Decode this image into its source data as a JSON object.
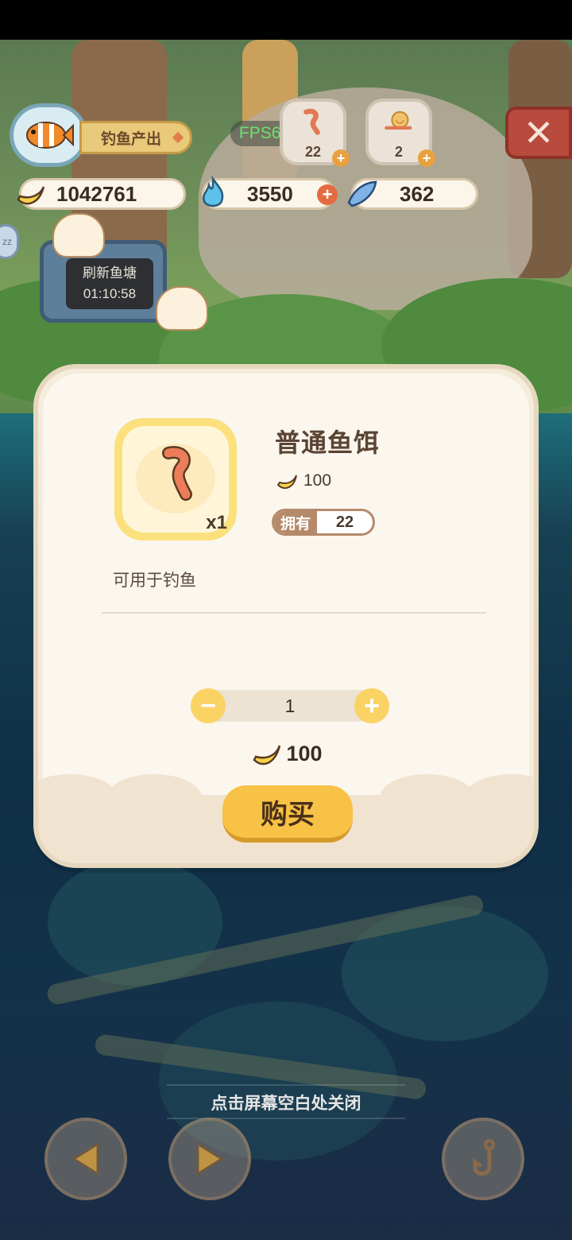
{
  "hud": {
    "fishing_output_label": "钓鱼产出",
    "fps": "FPS60",
    "bait_slots": [
      {
        "name": "worm-bait",
        "count": "22"
      },
      {
        "name": "snail-bait",
        "count": "2"
      }
    ],
    "currencies": [
      {
        "name": "banana",
        "value": "1042761"
      },
      {
        "name": "blue-flame",
        "value": "3550"
      },
      {
        "name": "blue-fish",
        "value": "362"
      }
    ],
    "refresh_pond": {
      "label": "刷新鱼塘",
      "timer": "01:10:58"
    }
  },
  "dialog": {
    "item_name": "普通鱼饵",
    "item_qty": "x1",
    "unit_price": "100",
    "owned_label": "拥有",
    "owned_value": "22",
    "description": "可用于钓鱼",
    "quantity": "1",
    "total_price": "100",
    "buy_label": "购买"
  },
  "hint": "点击屏幕空白处关闭",
  "colors": {
    "accent_yellow": "#f7c245",
    "brown_text": "#5a4434",
    "plus_red": "#e46b40"
  }
}
